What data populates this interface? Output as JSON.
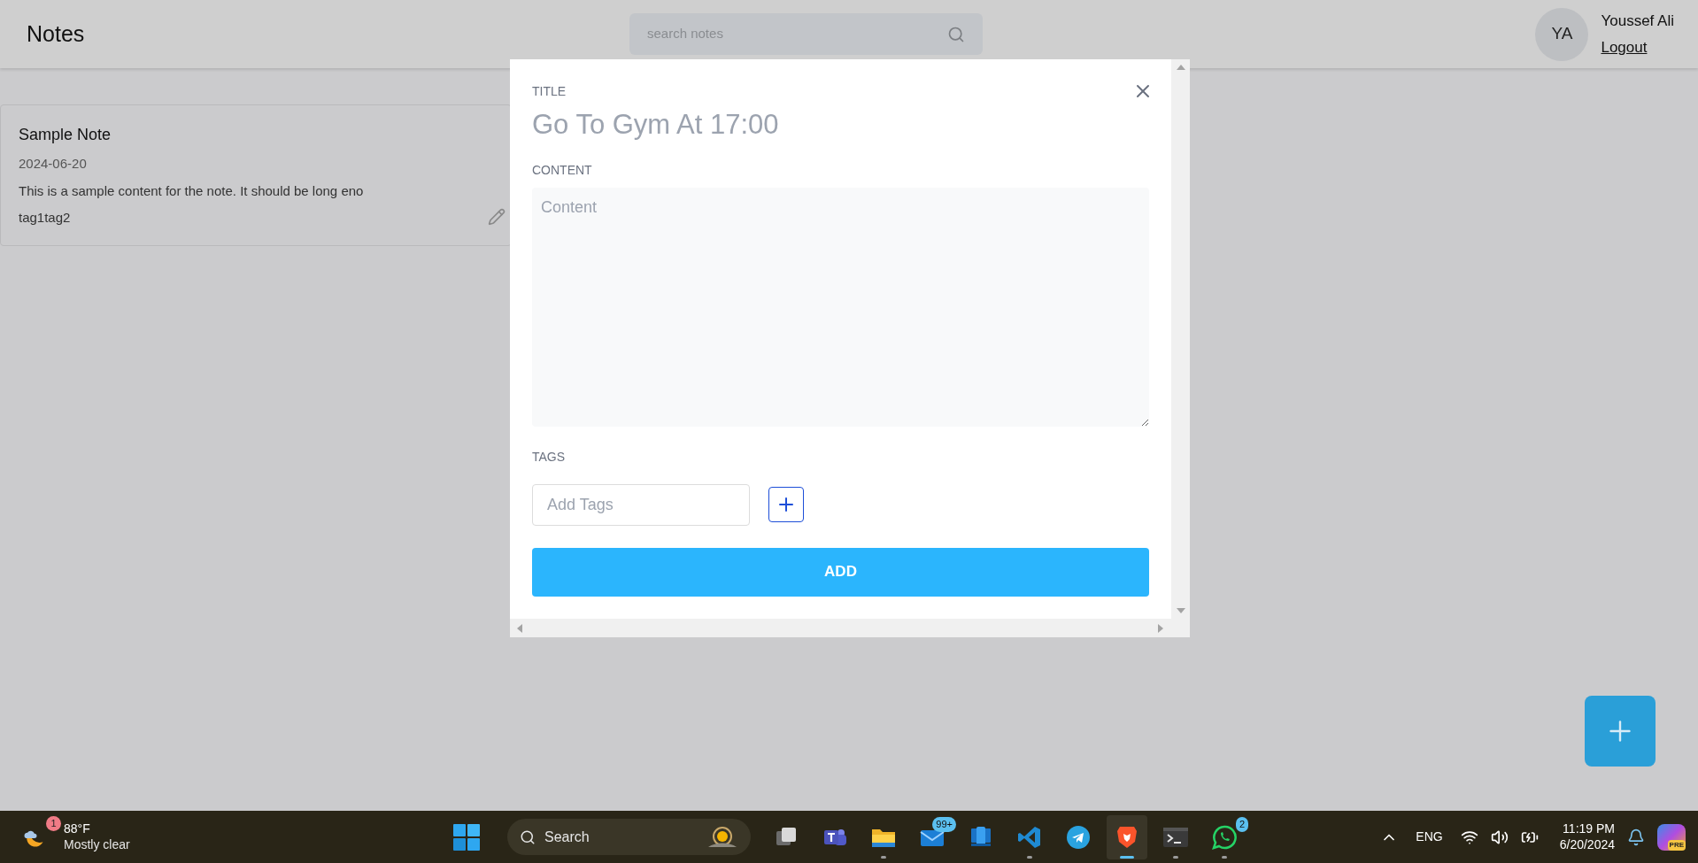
{
  "header": {
    "title": "Notes",
    "search": {
      "placeholder": "search notes"
    },
    "user": {
      "initials": "YA",
      "name": "Youssef Ali",
      "logout": "Logout"
    }
  },
  "notes": [
    {
      "title": "Sample Note",
      "date": "2024-06-20",
      "content": "This is a sample content for the note. It should be long eno",
      "tags": [
        "tag1",
        "tag2"
      ]
    }
  ],
  "modal": {
    "title_label": "TITLE",
    "title_value": "Go To Gym At 17:00",
    "content_label": "CONTENT",
    "content_placeholder": "Content",
    "tags_label": "TAGS",
    "tags_placeholder": "Add Tags",
    "submit": "ADD"
  },
  "taskbar": {
    "weather": {
      "badge": "1",
      "temp": "88°F",
      "condition": "Mostly clear"
    },
    "search": "Search",
    "apps": [
      {
        "kind": "taskview",
        "running": false,
        "selected": false
      },
      {
        "kind": "teams",
        "running": false,
        "selected": false
      },
      {
        "kind": "explorer",
        "running": true,
        "selected": false
      },
      {
        "kind": "mail",
        "badge": "99+",
        "running": false,
        "selected": false
      },
      {
        "kind": "phone",
        "running": false,
        "selected": false
      },
      {
        "kind": "vscode",
        "running": true,
        "selected": false
      },
      {
        "kind": "telegram",
        "running": false,
        "selected": false
      },
      {
        "kind": "brave",
        "running": true,
        "selected": true
      },
      {
        "kind": "terminal",
        "running": true,
        "selected": false
      },
      {
        "kind": "whatsapp",
        "badge": "2",
        "running": true,
        "selected": false
      }
    ],
    "tray": {
      "language": "ENG",
      "time": "11:19 PM",
      "date": "6/20/2024",
      "copilot_badge": "PRE"
    }
  }
}
